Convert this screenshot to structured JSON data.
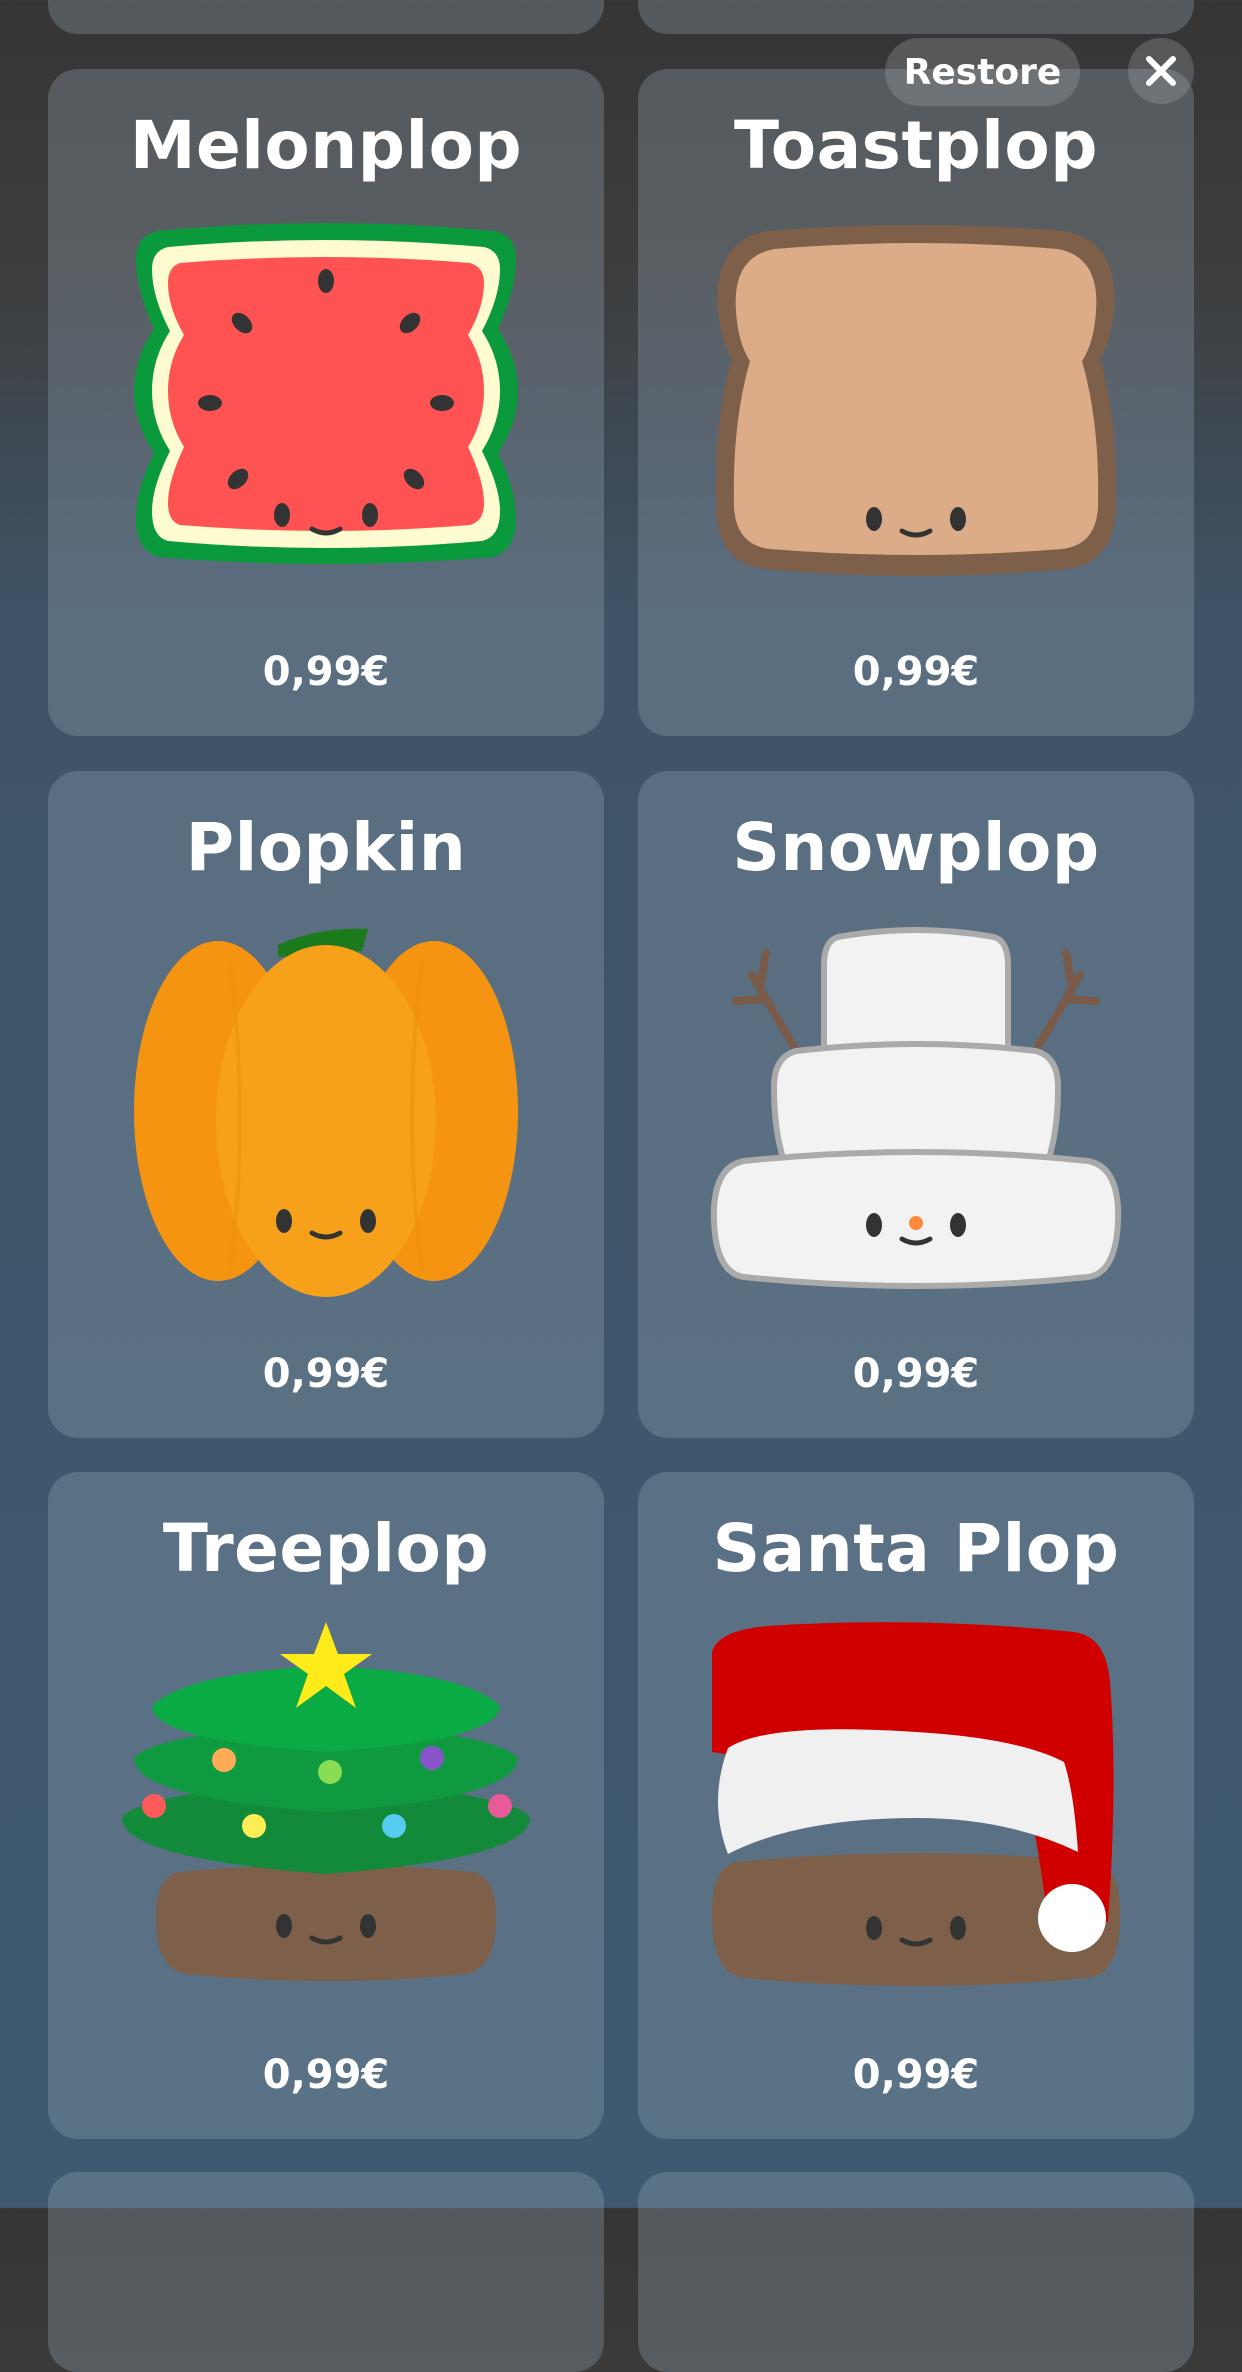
{
  "header": {
    "restore_label": "Restore",
    "close_icon": "close-icon"
  },
  "items": [
    {
      "name": "Melonplop",
      "price": "0,99€",
      "icon": "watermelon-character-icon"
    },
    {
      "name": "Toastplop",
      "price": "0,99€",
      "icon": "toast-character-icon"
    },
    {
      "name": "Plopkin",
      "price": "0,99€",
      "icon": "pumpkin-character-icon"
    },
    {
      "name": "Snowplop",
      "price": "0,99€",
      "icon": "snowman-character-icon"
    },
    {
      "name": "Treeplop",
      "price": "0,99€",
      "icon": "christmas-tree-character-icon"
    },
    {
      "name": "Santa Plop",
      "price": "0,99€",
      "icon": "santa-hat-character-icon"
    }
  ],
  "colors": {
    "card_text": "#ffffff",
    "melon_red": "#ff5252",
    "melon_green": "#0a9a3c",
    "toast_crust": "#7d5f4a",
    "toast_bread": "#dcab88",
    "pumpkin_orange": "#f7a11a",
    "santa_red": "#d10000"
  }
}
